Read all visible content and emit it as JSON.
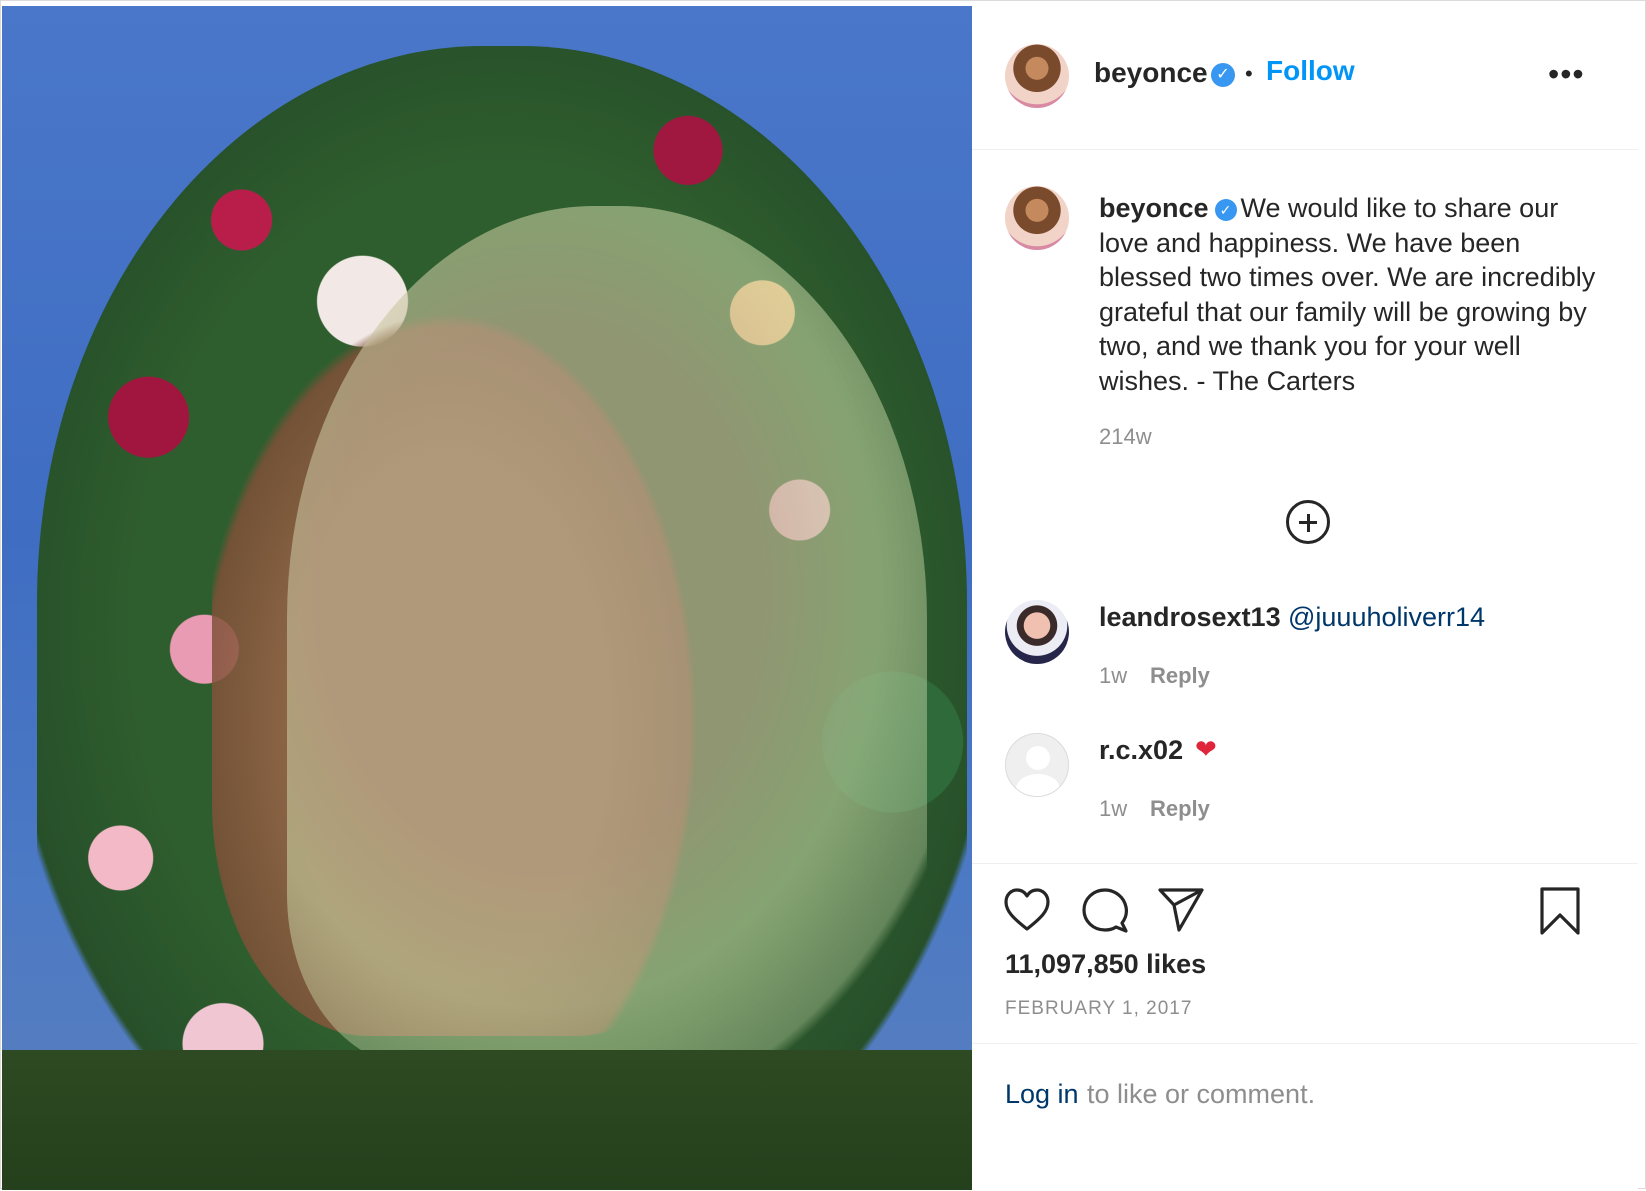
{
  "post": {
    "author": "beyonce",
    "follow_label": "Follow",
    "separator": "•",
    "more_label": "•••",
    "verified_mark": "✓"
  },
  "caption": {
    "username": "beyonce",
    "text": "We would like to share our love and happiness. We have been blessed two times over. We are incredibly grateful that our family will be growing by two, and we thank you for your well wishes. - The Carters",
    "age": "214w"
  },
  "comments": [
    {
      "username": "leandrosext13",
      "mention": "@juuuholiverr14",
      "age": "1w",
      "reply_label": "Reply"
    },
    {
      "username": "r.c.x02",
      "emoji": "❤",
      "age": "1w",
      "reply_label": "Reply"
    }
  ],
  "actions": {
    "like_icon": "heart-outline-icon",
    "comment_icon": "comment-bubble-icon",
    "share_icon": "paper-plane-icon",
    "save_icon": "bookmark-icon"
  },
  "stats": {
    "likes": "11,097,850 likes",
    "date": "FEBRUARY 1, 2017"
  },
  "footer": {
    "login_link": "Log in",
    "login_rest": "to like or comment."
  },
  "colors": {
    "link_blue": "#0095f6",
    "verified_blue": "#3897f0",
    "mention_navy": "#00376b",
    "muted_gray": "#8e8e8e",
    "text": "#262626"
  }
}
